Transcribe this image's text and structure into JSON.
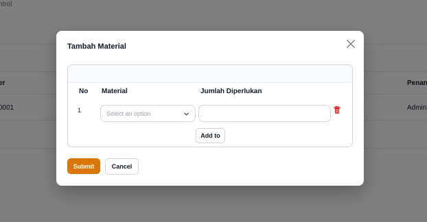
{
  "background": {
    "breadcrumb": "ntrol",
    "table_header_left": "er",
    "table_header_right": "Penan",
    "row_id": "0001",
    "row_right": "Admin"
  },
  "modal": {
    "title": "Tambah Material",
    "columns": {
      "no": "No",
      "material": "Material",
      "qty": "Jumlah Diperlukan"
    },
    "row": {
      "no": "1",
      "material_placeholder": "Select an option",
      "qty_value": ""
    },
    "add_to_label": "Add to",
    "submit_label": "Submit",
    "cancel_label": "Cancel"
  },
  "colors": {
    "accent": "#d97706",
    "delete": "#dc2626",
    "overlay": "rgba(0,0,0,0.5)"
  },
  "icons": {
    "close": "close-icon",
    "chevron": "chevron-down-icon",
    "delete": "trash-icon"
  }
}
